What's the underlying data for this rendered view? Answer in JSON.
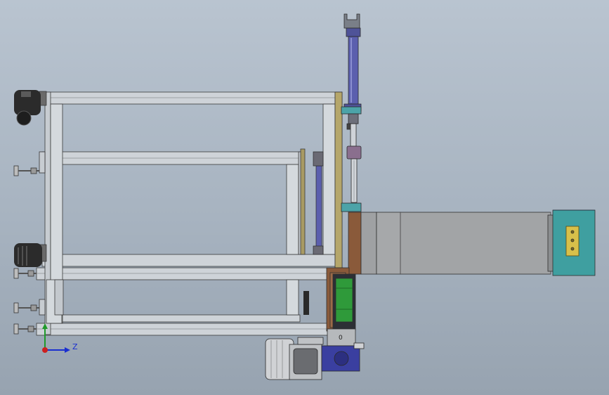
{
  "viewport": {
    "background": "gradient-gray-blue",
    "triad": {
      "axis_label": "Z"
    }
  },
  "colors": {
    "frame": "#c9ced3",
    "frame_edge": "#3a3a3a",
    "cylinder": "#5b5fae",
    "rod": "#cfd3d8",
    "teal_block": "#4ca3a8",
    "bracket": "#a89a63",
    "brown_plate": "#8a5a3a",
    "green_part": "#2f9a3a",
    "conveyor": "#a2a4a6",
    "conveyor_end": "#3f9fa0",
    "clamp": "#d8c04a",
    "motor": "#cfd1d4",
    "gearbox": "#3a3fa0",
    "caster": "#2b2b2b",
    "axis_z": "#1a2fd0",
    "axis_y": "#1f9a2a",
    "axis_x": "#cc2020"
  },
  "icons": {
    "caster": "caster-wheel-icon",
    "leveling_foot": "leveling-foot-icon",
    "triad": "coordinate-triad-icon"
  }
}
